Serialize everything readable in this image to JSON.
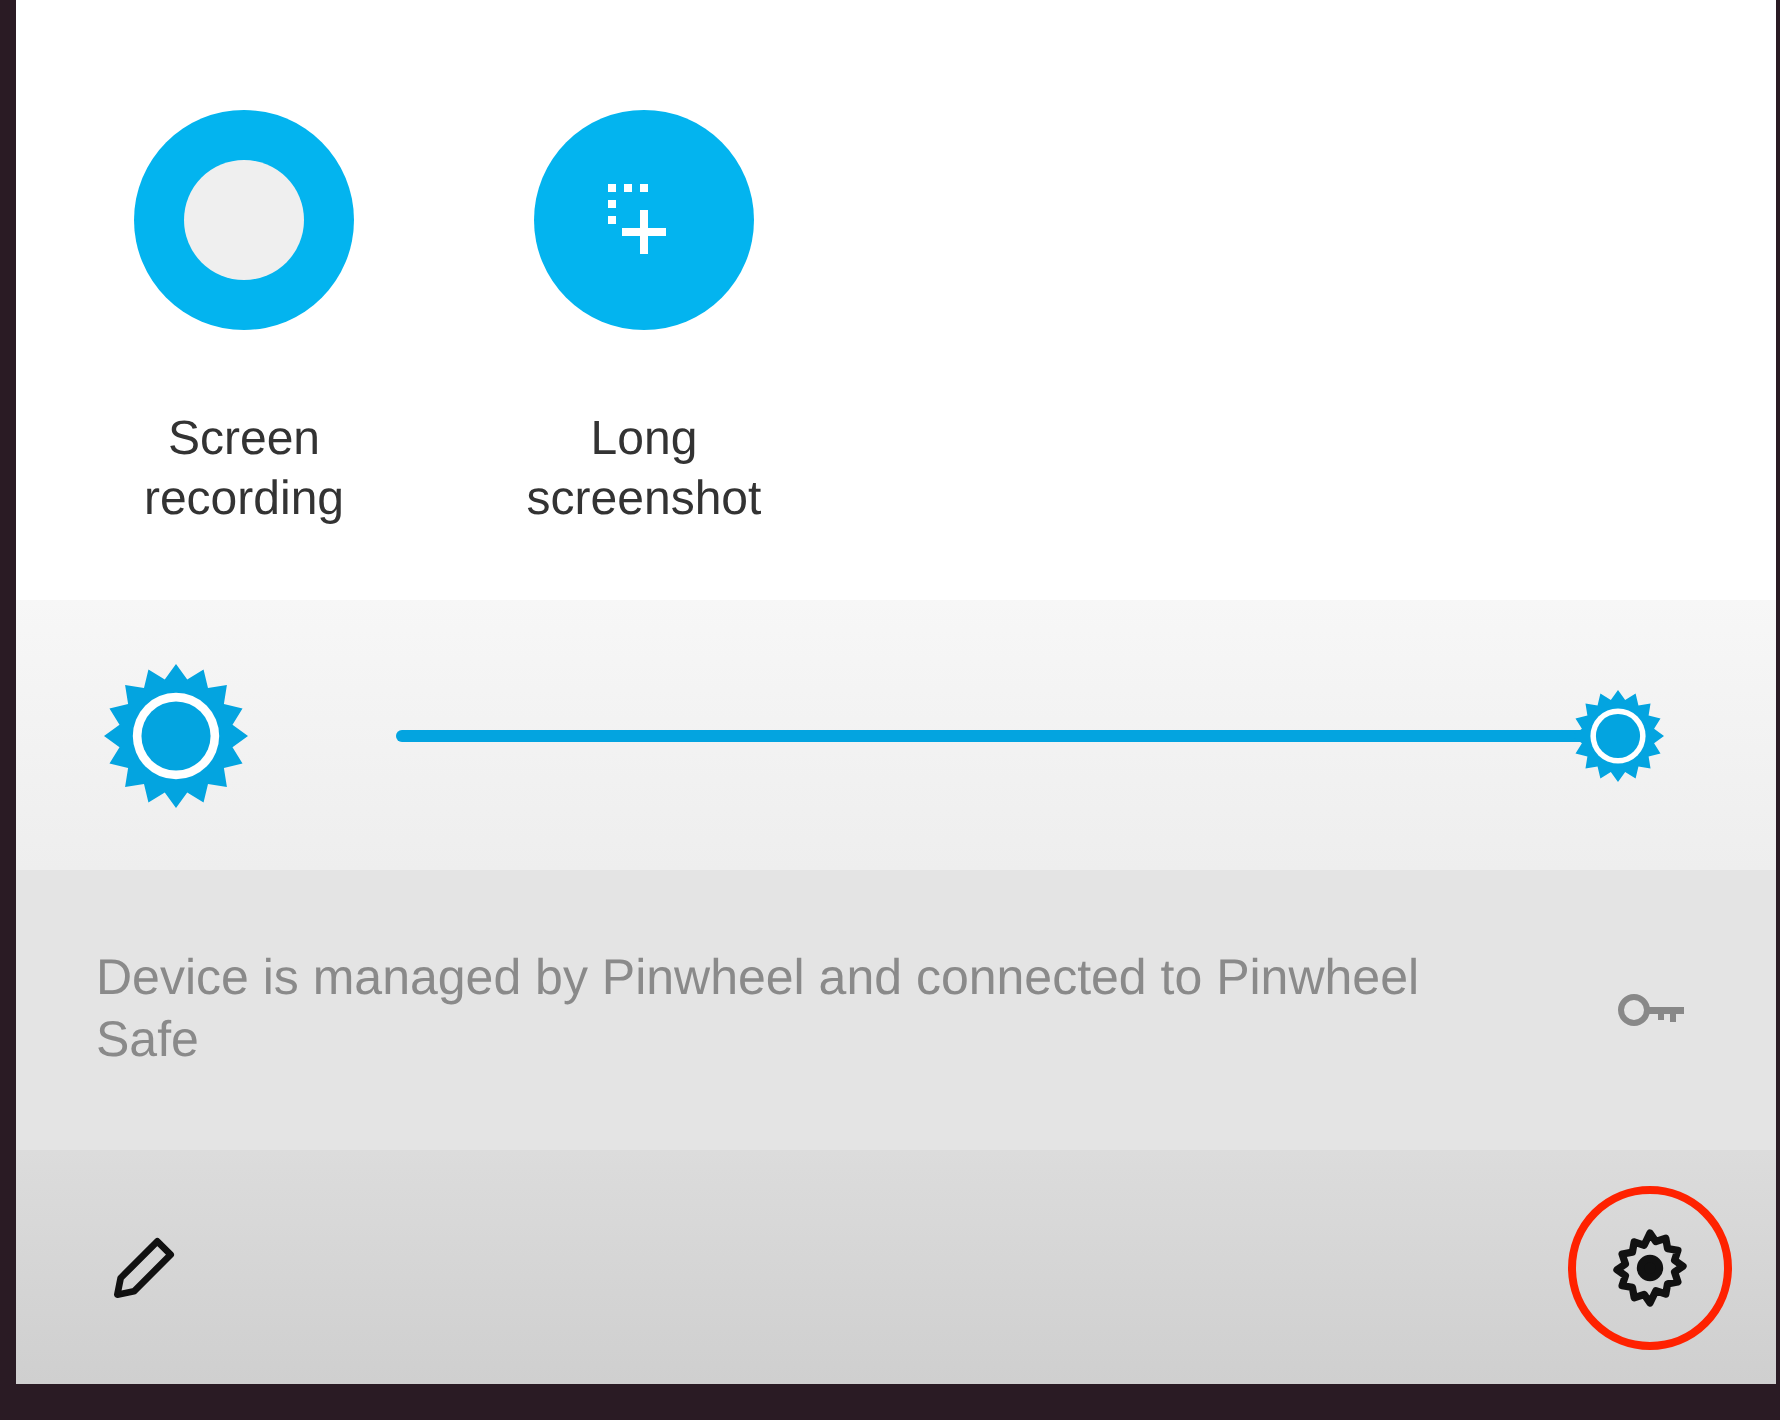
{
  "tiles": [
    {
      "kind": "record",
      "label": "Screen recording"
    },
    {
      "kind": "screenshot",
      "label": "Long screenshot"
    }
  ],
  "brightness": {
    "level": 1
  },
  "device_notice": {
    "text": "Device is managed by Pinwheel and connected to Pinwheel Safe"
  },
  "footer": {
    "settings_highlighted": true
  }
}
